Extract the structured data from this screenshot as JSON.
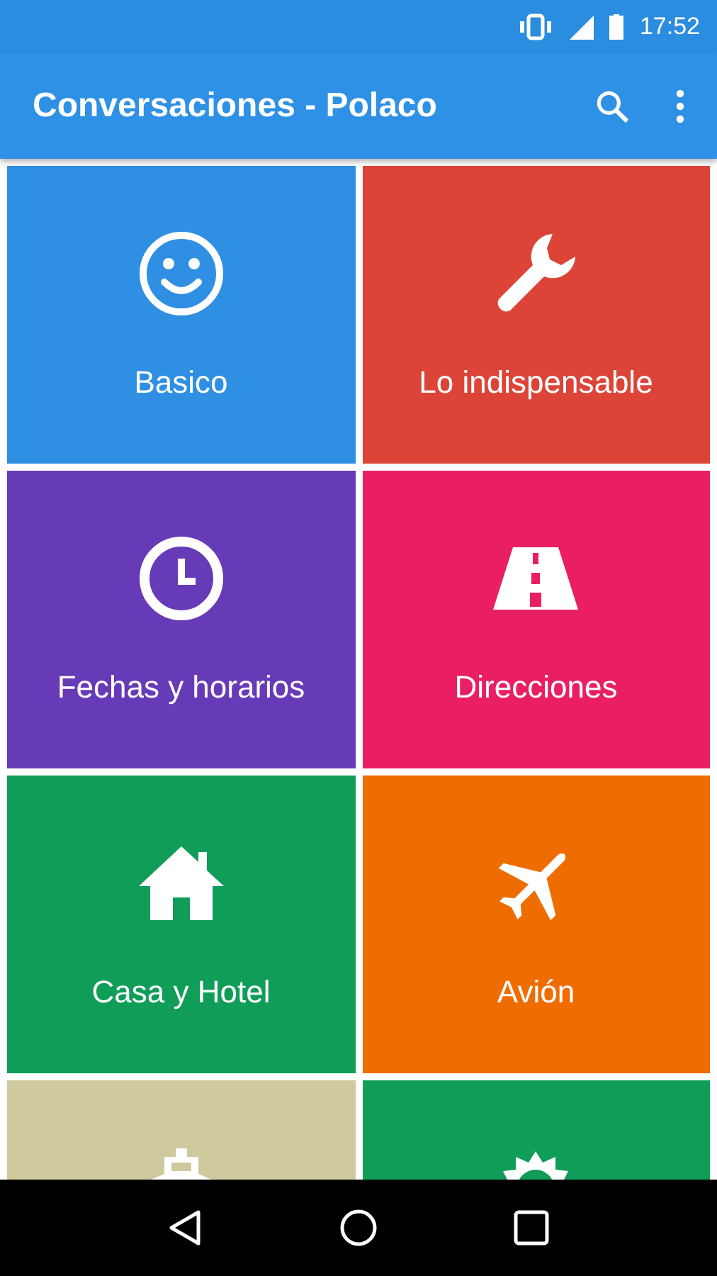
{
  "status_bar": {
    "time": "17:52"
  },
  "app_bar": {
    "title": "Conversaciones - Polaco"
  },
  "tiles": [
    {
      "kind": "smiley",
      "label": "Basico",
      "color": "#2e8fe3"
    },
    {
      "kind": "wrench",
      "label": "Lo indispensable",
      "color": "#db4437"
    },
    {
      "kind": "clock",
      "label": "Fechas y horarios",
      "color": "#673ab7"
    },
    {
      "kind": "road",
      "label": "Direcciones",
      "color": "#e91e63"
    },
    {
      "kind": "house",
      "label": "Casa y Hotel",
      "color": "#0f9d58"
    },
    {
      "kind": "plane",
      "label": "Avión",
      "color": "#ef6c00"
    },
    {
      "kind": "ship",
      "color": "#cfc99e"
    },
    {
      "kind": "sun",
      "color": "#0f9d58"
    }
  ]
}
